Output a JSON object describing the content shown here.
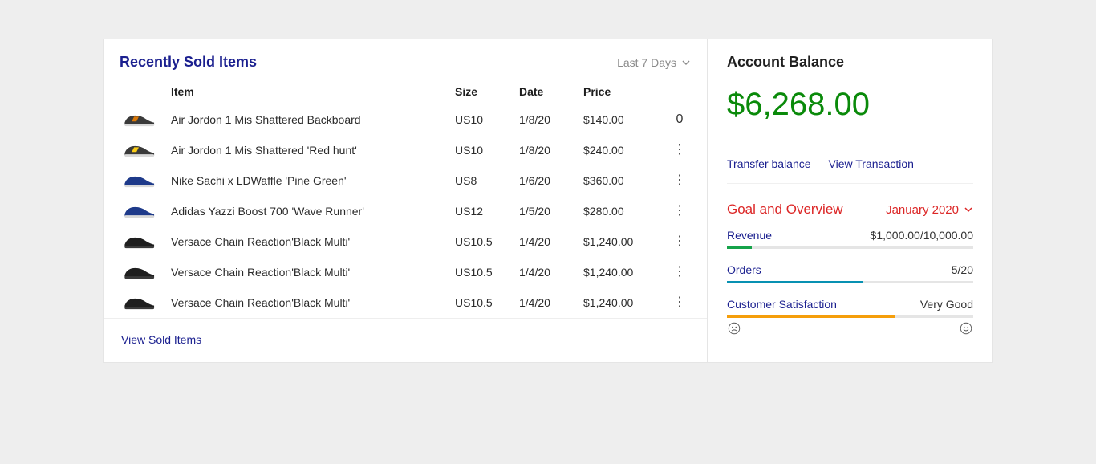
{
  "sold": {
    "title": "Recently Sold Items",
    "filter_label": "Last 7 Days",
    "columns": {
      "item": "Item",
      "size": "Size",
      "date": "Date",
      "price": "Price"
    },
    "rows": [
      {
        "name": "Air Jordon 1 Mis Shattered Backboard",
        "size": "US10",
        "date": "1/8/20",
        "price": "$140.00",
        "actions": "0",
        "shoe": "orange"
      },
      {
        "name": "Air Jordon 1 Mis Shattered 'Red hunt'",
        "size": "US10",
        "date": "1/8/20",
        "price": "$240.00",
        "actions": "dots",
        "shoe": "yellow"
      },
      {
        "name": "Nike Sachi x LDWaffle 'Pine Green'",
        "size": "US8",
        "date": "1/6/20",
        "price": "$360.00",
        "actions": "dots",
        "shoe": "blue"
      },
      {
        "name": "Adidas Yazzi Boost 700 'Wave Runner'",
        "size": "US12",
        "date": "1/5/20",
        "price": "$280.00",
        "actions": "dots",
        "shoe": "blue"
      },
      {
        "name": "Versace Chain Reaction'Black Multi'",
        "size": "US10.5",
        "date": "1/4/20",
        "price": "$1,240.00",
        "actions": "dots",
        "shoe": "black"
      },
      {
        "name": "Versace Chain Reaction'Black Multi'",
        "size": "US10.5",
        "date": "1/4/20",
        "price": "$1,240.00",
        "actions": "dots",
        "shoe": "black"
      },
      {
        "name": "Versace Chain Reaction'Black Multi'",
        "size": "US10.5",
        "date": "1/4/20",
        "price": "$1,240.00",
        "actions": "dots",
        "shoe": "black"
      }
    ],
    "footer_link": "View Sold Items"
  },
  "balance": {
    "title": "Account Balance",
    "amount": "$6,268.00",
    "links": {
      "transfer": "Transfer balance",
      "view": "View Transaction"
    }
  },
  "goal": {
    "title": "Goal and Overview",
    "month": "January 2020",
    "revenue": {
      "label": "Revenue",
      "value": "$1,000.00/10,000.00",
      "pct": 10
    },
    "orders": {
      "label": "Orders",
      "value": "5/20",
      "pct": 55
    },
    "satisfaction": {
      "label": "Customer Satisfaction",
      "value": "Very Good",
      "pct": 68
    }
  },
  "colors": {
    "shoe_orange": "#d97706",
    "shoe_yellow": "#facc15",
    "shoe_blue": "#1e3a8a",
    "shoe_black": "#1f1f1f"
  }
}
